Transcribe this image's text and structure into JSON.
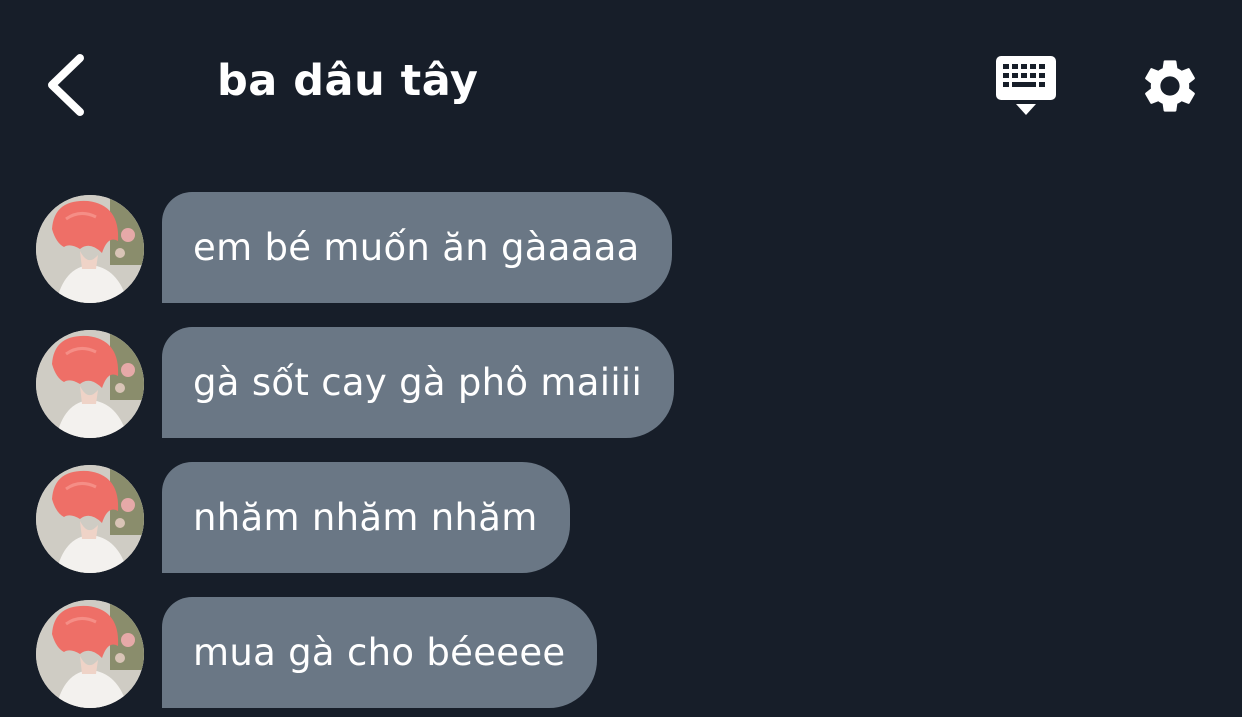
{
  "header": {
    "back_icon": "chevron-left-icon",
    "title": "ba dâu tây",
    "keyboard_icon": "keyboard-icon",
    "settings_icon": "gear-icon"
  },
  "colors": {
    "background": "#171e29",
    "bubble": "#6a7785",
    "text": "#ffffff"
  },
  "messages": [
    {
      "text": "em bé muốn ăn gàaaaa"
    },
    {
      "text": "gà sốt cay gà phô maiiii"
    },
    {
      "text": "nhăm nhăm nhăm"
    },
    {
      "text": "mua gà cho béeeee"
    }
  ]
}
